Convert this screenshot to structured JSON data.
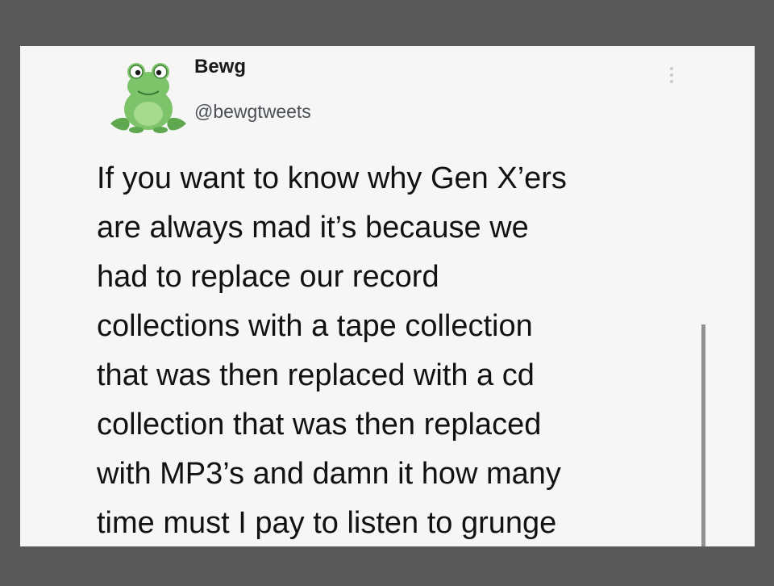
{
  "tweet": {
    "author_name": "Bewg",
    "author_handle": "@bewgtweets",
    "avatar_icon": "frog-icon",
    "more_icon": "more-vertical-icon",
    "text_lines": [
      "If you want to know why Gen X’ers",
      "are always mad it’s because we",
      "had to replace our record",
      "collections with a tape collection",
      "that was then replaced with a cd",
      "collection that was then replaced",
      "with MP3’s and damn it how many",
      "time must I pay to listen to grunge"
    ]
  },
  "colors": {
    "frame_background": "#585858",
    "card_background": "#f6f6f6",
    "text": "#121212",
    "handle_text": "#4a4f55",
    "frog_green": "#7cc36a"
  }
}
